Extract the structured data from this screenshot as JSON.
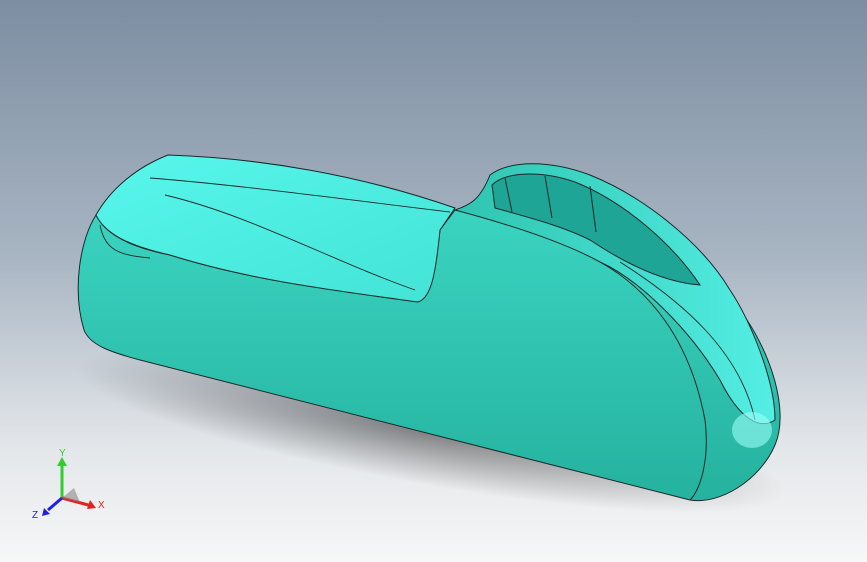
{
  "viewport": {
    "background_top": "#7d8ea2",
    "background_bottom": "#f6f7f7"
  },
  "model": {
    "shading_color": "#2fc9b4",
    "highlight_color": "#5ff8ef",
    "edge_color": "#1a2a2a"
  },
  "triad": {
    "y_label": "Y",
    "x_label": "X",
    "z_label": "Z",
    "y_color": "#33cc33",
    "x_color": "#e62020",
    "z_color": "#2020e6"
  }
}
